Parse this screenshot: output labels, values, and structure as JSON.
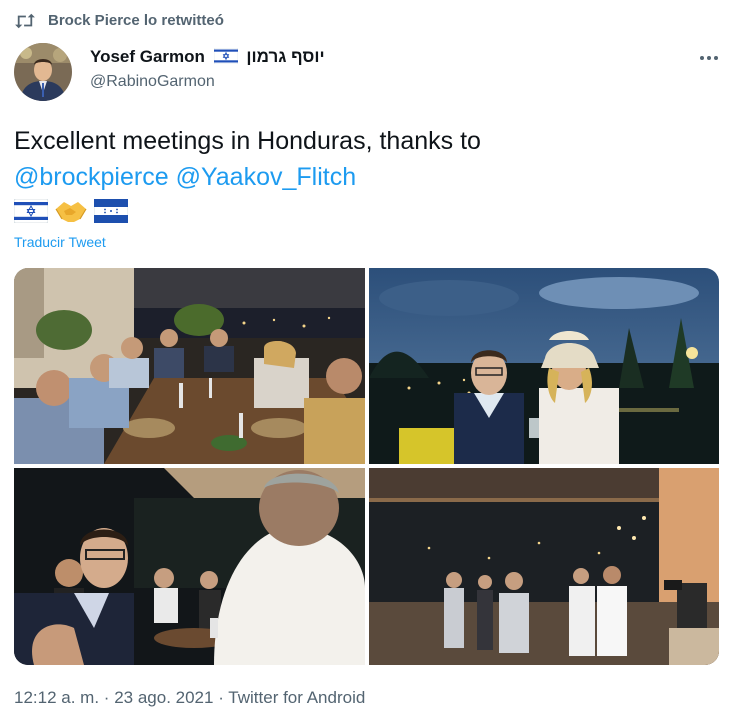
{
  "retweet": {
    "icon": "retweet-icon",
    "text": "Brock Pierce lo retwitteó"
  },
  "author": {
    "avatar_icon": "avatar",
    "name": "Yosef Garmon",
    "flag": "israel-flag-icon",
    "name_hebrew": "יוסף גרמון",
    "handle": "@RabinoGarmon"
  },
  "menu": {
    "icon": "more-options-icon"
  },
  "tweet": {
    "text_line1": "Excellent meetings in Honduras, thanks to",
    "mention1": "@brockpierce",
    "mention2": "@Yaakov_Flitch",
    "emojis": [
      "israel-flag-icon",
      "handshake-icon",
      "honduras-flag-icon"
    ],
    "translate": "Traducir Tweet"
  },
  "media": {
    "count": 4,
    "photos": [
      "group-dinner-photo",
      "two-men-night-photo",
      "handshake-conversation-photo",
      "terrace-gathering-photo"
    ]
  },
  "meta": {
    "time": "12:12 a. m.",
    "separator": "·",
    "date": "23 ago. 2021",
    "source": "Twitter for Android"
  },
  "colors": {
    "accent": "#1d9bf0",
    "secondary_text": "#536471",
    "primary_text": "#0f1419"
  }
}
